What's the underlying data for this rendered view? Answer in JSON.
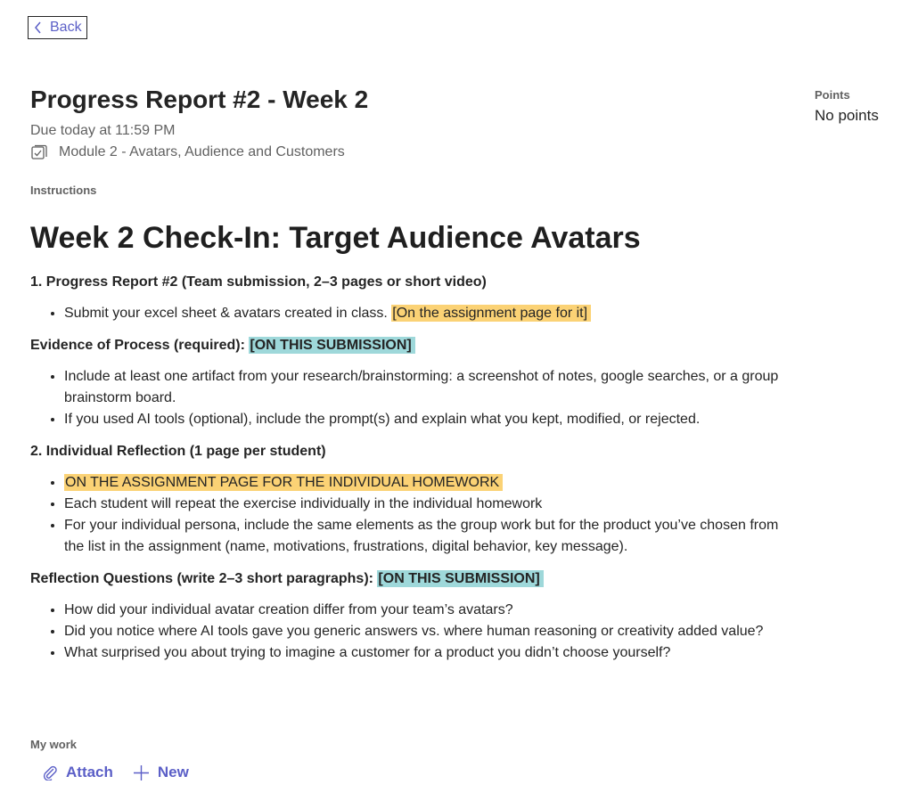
{
  "back": {
    "label": "Back"
  },
  "assignment": {
    "title": "Progress Report #2 - Week 2",
    "due": "Due today at 11:59 PM",
    "module": "Module 2 - Avatars, Audience and Customers"
  },
  "points": {
    "label": "Points",
    "value": "No points"
  },
  "instructions": {
    "label": "Instructions",
    "heading": "Week 2 Check-In: Target Audience Avatars",
    "section1": {
      "title": "1. Progress Report #2 (Team submission, 2–3 pages or short video)",
      "item1_text": "Submit your excel sheet & avatars created in class. ",
      "item1_highlight": "[On the assignment page for it]"
    },
    "evidence": {
      "title": "Evidence of Process (required): ",
      "highlight": "[ON THIS SUBMISSION]",
      "items": [
        "Include at least one artifact from your research/brainstorming: a screenshot of notes, google searches, or a group brainstorm board.",
        "If you used AI tools (optional), include the prompt(s) and explain what you kept, modified, or rejected."
      ]
    },
    "section2": {
      "title": "2. Individual Reflection (1 page per student)",
      "item1_highlight": "ON THE ASSIGNMENT PAGE FOR THE INDIVIDUAL HOMEWORK",
      "item2": "Each student will repeat the exercise individually in the individual homework",
      "item3": "For your individual persona, include the same elements as the group work but for the product you’ve chosen from the list in the assignment  (name, motivations, frustrations, digital behavior, key message)."
    },
    "reflection": {
      "title": "Reflection Questions (write 2–3 short paragraphs): ",
      "highlight": "[ON THIS SUBMISSION]",
      "items": [
        "How did your individual avatar creation differ from your team’s avatars?",
        "Did you notice where AI tools gave you generic answers vs. where human reasoning or creativity added value?",
        "What surprised you about trying to imagine a customer for a product you didn’t choose yourself?"
      ]
    }
  },
  "my_work": {
    "label": "My work",
    "attach_label": "Attach",
    "new_label": "New"
  },
  "colors": {
    "accent": "#5b5fc7",
    "highlight_yellow": "#fbd275",
    "highlight_teal": "#9ed8da"
  },
  "icons": [
    "chevron-left-icon",
    "module-icon",
    "paperclip-icon",
    "plus-icon"
  ]
}
